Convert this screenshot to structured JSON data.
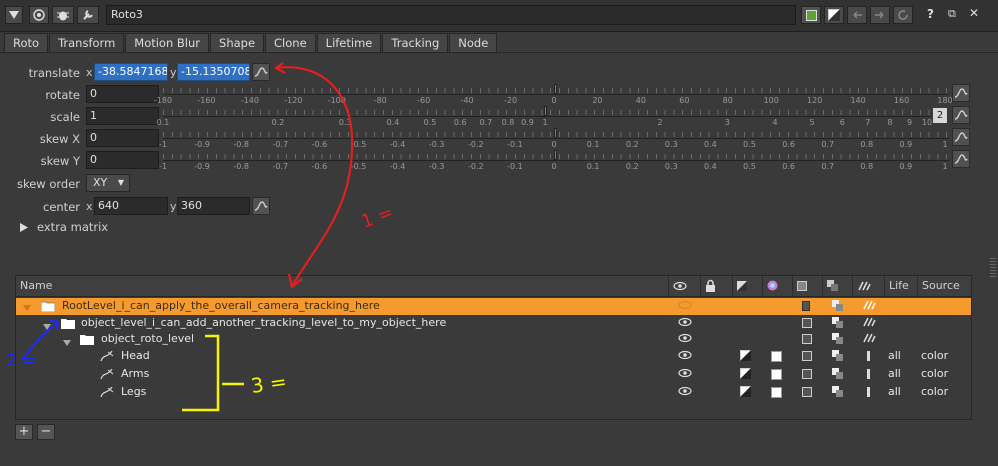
{
  "titlebar": {
    "node_name": "Roto3",
    "help": "?",
    "float": "⧉",
    "close": "✕"
  },
  "tabs": [
    "Roto",
    "Transform",
    "Motion Blur",
    "Shape",
    "Clone",
    "Lifetime",
    "Tracking",
    "Node"
  ],
  "active_tab": "Transform",
  "transform": {
    "translate_label": "translate",
    "translate_x": "-38.58471684",
    "translate_y": "-15.13507088",
    "rotate_label": "rotate",
    "rotate_value": "0",
    "scale_label": "scale",
    "scale_value": "1",
    "scale_channels": "2",
    "skewx_label": "skew X",
    "skewx_value": "0",
    "skewy_label": "skew Y",
    "skewy_value": "0",
    "skew_order_label": "skew order",
    "skew_order_value": "XY",
    "center_label": "center",
    "center_x": "640",
    "center_y": "360",
    "x_label": "x",
    "y_label": "y",
    "extra_matrix_label": "extra matrix"
  },
  "sliders": {
    "rotate_ticks": [
      "-180",
      "-160",
      "-140",
      "-120",
      "-100",
      "-80",
      "-60",
      "-40",
      "-20",
      "0",
      "20",
      "40",
      "60",
      "80",
      "100",
      "120",
      "140",
      "160",
      "180"
    ],
    "scale_ticks": [
      "0.1",
      "0.2",
      "0.3",
      "0.4",
      "0.5",
      "0.6",
      "0.7",
      "0.8",
      "0.9",
      "1",
      "2",
      "3",
      "4",
      "5",
      "6",
      "7",
      "8",
      "9",
      "10"
    ],
    "skew_ticks": [
      "-1",
      "-0.9",
      "-0.8",
      "-0.7",
      "-0.6",
      "-0.5",
      "-0.4",
      "-0.3",
      "-0.2",
      "-0.1",
      "0",
      "0.1",
      "0.2",
      "0.3",
      "0.4",
      "0.5",
      "0.6",
      "0.7",
      "0.8",
      "0.9",
      "1"
    ]
  },
  "tree": {
    "columns": {
      "name": "Name",
      "life": "Life",
      "source": "Source"
    },
    "rows": [
      {
        "name": "RootLevel_i_can_apply_the_overall_camera_tracking_here",
        "life": "",
        "source": ""
      },
      {
        "name": "object_level_i_can_add_another_tracking_level_to_my_object_here",
        "life": "",
        "source": ""
      },
      {
        "name": "object_roto_level",
        "life": "",
        "source": ""
      },
      {
        "name": "Head",
        "life": "all",
        "source": "color"
      },
      {
        "name": "Arms",
        "life": "all",
        "source": "color"
      },
      {
        "name": "Legs",
        "life": "all",
        "source": "color"
      }
    ]
  },
  "buttons": {
    "add": "+",
    "remove": "−"
  },
  "annotations": {
    "red": "1 =",
    "blue": "2 =",
    "yellow": "3 ="
  },
  "colors": {
    "selection": "#f59a2c",
    "field_selected": "#2f6fc4",
    "red_annotation": "#e02020",
    "blue_annotation": "#1a2cff",
    "yellow_annotation": "#f5f500"
  }
}
